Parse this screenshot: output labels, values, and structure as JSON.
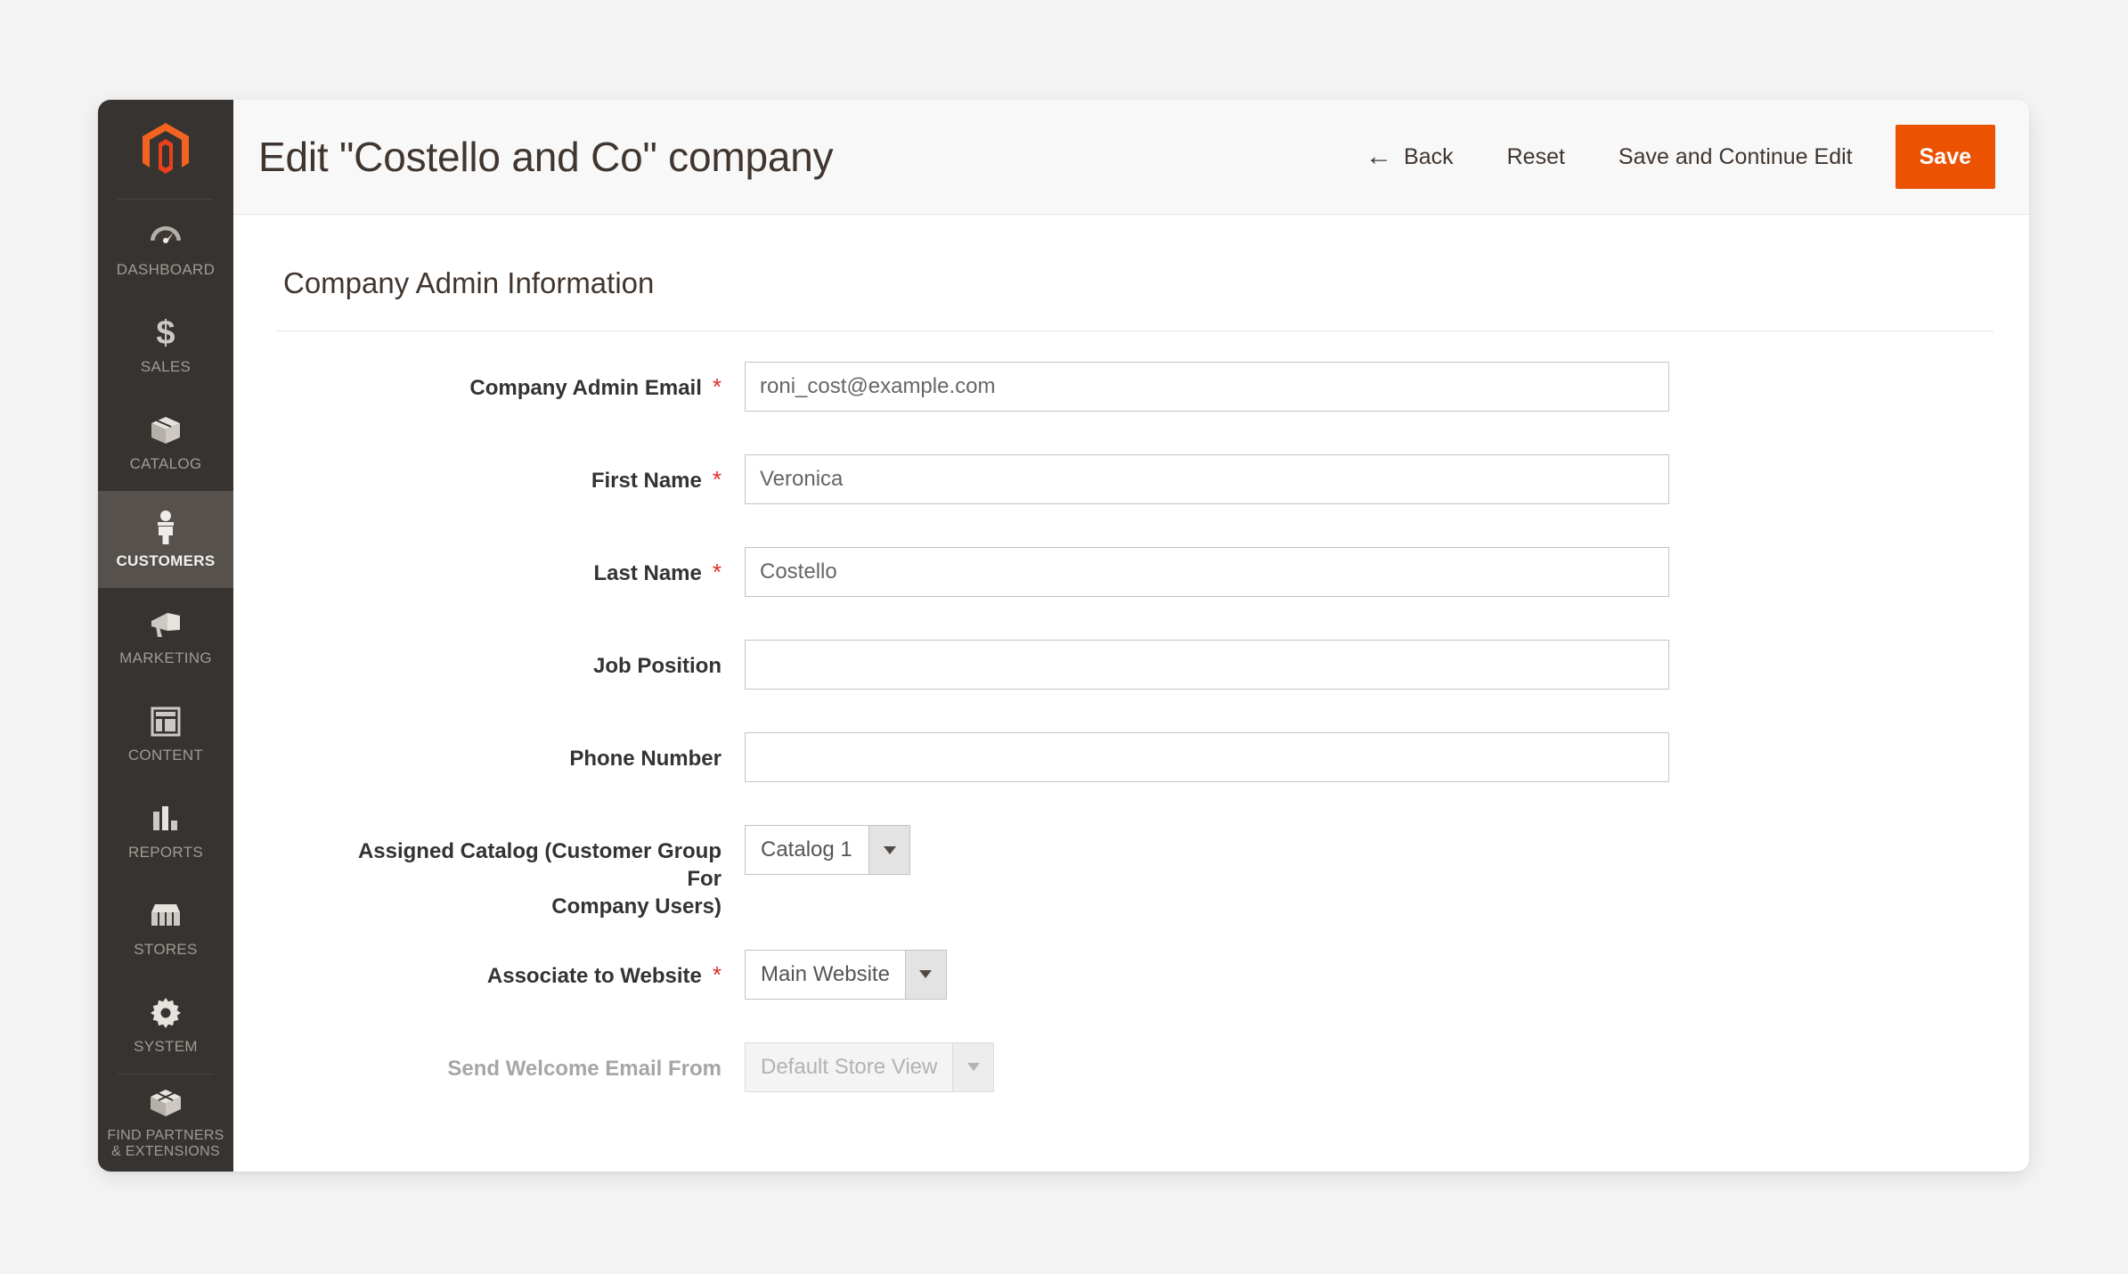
{
  "theme": {
    "accent": "#eb5202",
    "sidebar_bg": "#373330",
    "sidebar_active_bg": "#56514c",
    "header_bg": "#f8f8f8",
    "page_bg": "#f4f4f4",
    "required_star_color": "#e02b27",
    "label_color": "#333333",
    "input_border": "#c2c2c2"
  },
  "sidebar": {
    "logo_icon": "magento-logo-icon",
    "items": [
      {
        "label": "DASHBOARD",
        "icon": "dashboard-gauge-icon",
        "active": false,
        "divider_above": false
      },
      {
        "label": "SALES",
        "icon": "dollar-sign-icon",
        "active": false,
        "divider_above": false
      },
      {
        "label": "CATALOG",
        "icon": "box-icon",
        "active": false,
        "divider_above": false
      },
      {
        "label": "CUSTOMERS",
        "icon": "person-icon",
        "active": true,
        "divider_above": false
      },
      {
        "label": "MARKETING",
        "icon": "megaphone-icon",
        "active": false,
        "divider_above": false
      },
      {
        "label": "CONTENT",
        "icon": "layout-window-icon",
        "active": false,
        "divider_above": false
      },
      {
        "label": "REPORTS",
        "icon": "bar-chart-icon",
        "active": false,
        "divider_above": false
      },
      {
        "label": "STORES",
        "icon": "storefront-icon",
        "active": false,
        "divider_above": false
      },
      {
        "label": "SYSTEM",
        "icon": "gear-icon",
        "active": false,
        "divider_above": false
      },
      {
        "label": "FIND PARTNERS\n& EXTENSIONS",
        "label_line1": "FIND PARTNERS",
        "label_line2": "& EXTENSIONS",
        "icon": "extension-cube-icon",
        "active": false,
        "divider_above": true
      }
    ]
  },
  "header": {
    "title": "Edit \"Costello and Co\" company",
    "back_label": "Back",
    "back_icon": "arrow-left-icon",
    "reset_label": "Reset",
    "save_continue_label": "Save and Continue Edit",
    "save_label": "Save"
  },
  "main": {
    "section_title": "Company Admin Information",
    "fields": [
      {
        "id": "company-admin-email",
        "label": "Company Admin Email",
        "required": true,
        "type": "text",
        "value": "roni_cost@example.com",
        "placeholder": "",
        "disabled": false
      },
      {
        "id": "first-name",
        "label": "First Name",
        "required": true,
        "type": "text",
        "value": "Veronica",
        "placeholder": "",
        "disabled": false
      },
      {
        "id": "last-name",
        "label": "Last Name",
        "required": true,
        "type": "text",
        "value": "Costello",
        "placeholder": "",
        "disabled": false
      },
      {
        "id": "job-position",
        "label": "Job Position",
        "required": false,
        "type": "text",
        "value": "",
        "placeholder": "",
        "disabled": false
      },
      {
        "id": "phone-number",
        "label": "Phone Number",
        "required": false,
        "type": "text",
        "value": "",
        "placeholder": "",
        "disabled": false
      },
      {
        "id": "assigned-catalog",
        "label_line1": "Assigned Catalog (Customer Group For",
        "label_line2": "Company Users)",
        "label": "Assigned Catalog (Customer Group For Company Users)",
        "required": false,
        "type": "select",
        "value": "Catalog 1",
        "disabled": false
      },
      {
        "id": "associate-to-website",
        "label": "Associate to Website",
        "required": true,
        "type": "select",
        "value": "Main Website",
        "disabled": false
      },
      {
        "id": "send-welcome-email-from",
        "label": "Send Welcome Email From",
        "required": false,
        "type": "select",
        "value": "Default Store View",
        "disabled": true
      }
    ]
  }
}
